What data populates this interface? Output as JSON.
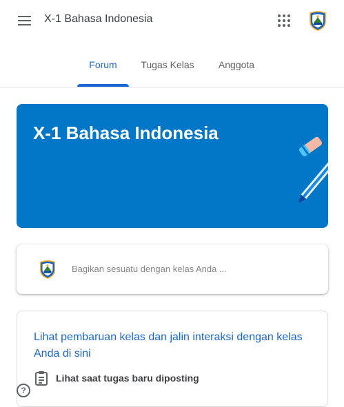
{
  "app": {
    "title": "X-1 Bahasa Indonesia",
    "icons": {
      "menu": "menu-icon",
      "apps": "apps-grid-icon",
      "avatar": "school-logo-avatar"
    }
  },
  "tabs": [
    {
      "label": "Forum",
      "active": true
    },
    {
      "label": "Tugas Kelas",
      "active": false
    },
    {
      "label": "Anggota",
      "active": false
    }
  ],
  "banner": {
    "title": "X-1 Bahasa Indonesia",
    "color": "#0277c7",
    "illustration": "pencil-icon"
  },
  "share": {
    "placeholder": "Bagikan sesuatu dengan kelas Anda ..."
  },
  "info": {
    "text": "Lihat pembaruan kelas dan jalin interaksi dengan kelas Anda di sini",
    "item_label": "Lihat saat tugas baru diposting",
    "item_icon": "assignment-icon"
  },
  "help_icon": "help-icon",
  "colors": {
    "accent": "#1967d2",
    "banner": "#0277c7"
  }
}
